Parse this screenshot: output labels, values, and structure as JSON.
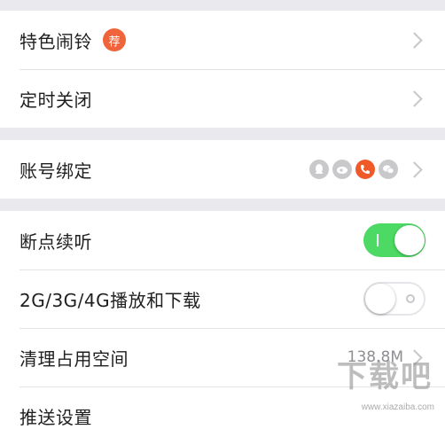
{
  "rows": {
    "alarm": {
      "label": "特色闹铃",
      "badge": "荐"
    },
    "timer": {
      "label": "定时关闭"
    },
    "account": {
      "label": "账号绑定"
    },
    "resume": {
      "label": "断点续听",
      "toggle": "on"
    },
    "mobile": {
      "label": "2G/3G/4G播放和下载",
      "toggle": "off"
    },
    "clear": {
      "label": "清理占用空间",
      "value": "138.8M"
    },
    "push": {
      "label": "推送设置"
    }
  },
  "social_icons": [
    "qq-icon",
    "weibo-icon",
    "phone-icon",
    "wechat-icon"
  ],
  "colors": {
    "accent": "#f0643c",
    "toggle_on": "#4cd964",
    "background": "#e9e9ee"
  },
  "watermark": {
    "title": "下载吧",
    "url": "www.xiazaiba.com"
  }
}
